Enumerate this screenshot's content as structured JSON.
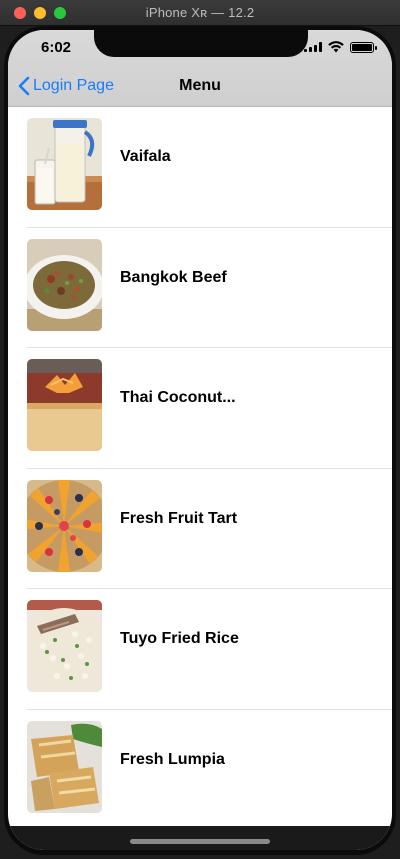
{
  "window": {
    "title": "iPhone Xʀ — 12.2"
  },
  "status_bar": {
    "time": "6:02",
    "battery_level": 1.0
  },
  "nav": {
    "back_label": "Login Page",
    "title": "Menu"
  },
  "menu_items": [
    {
      "label": "Vaifala",
      "image": "coconut-milk-drink-photo"
    },
    {
      "label": "Bangkok Beef",
      "image": "beef-dish-photo"
    },
    {
      "label": "Thai Coconut...",
      "image": "coconut-cake-photo"
    },
    {
      "label": "Fresh Fruit Tart",
      "image": "fruit-tart-photo"
    },
    {
      "label": "Tuyo Fried Rice",
      "image": "fried-rice-photo"
    },
    {
      "label": "Fresh Lumpia",
      "image": "lumpia-photo"
    }
  ]
}
